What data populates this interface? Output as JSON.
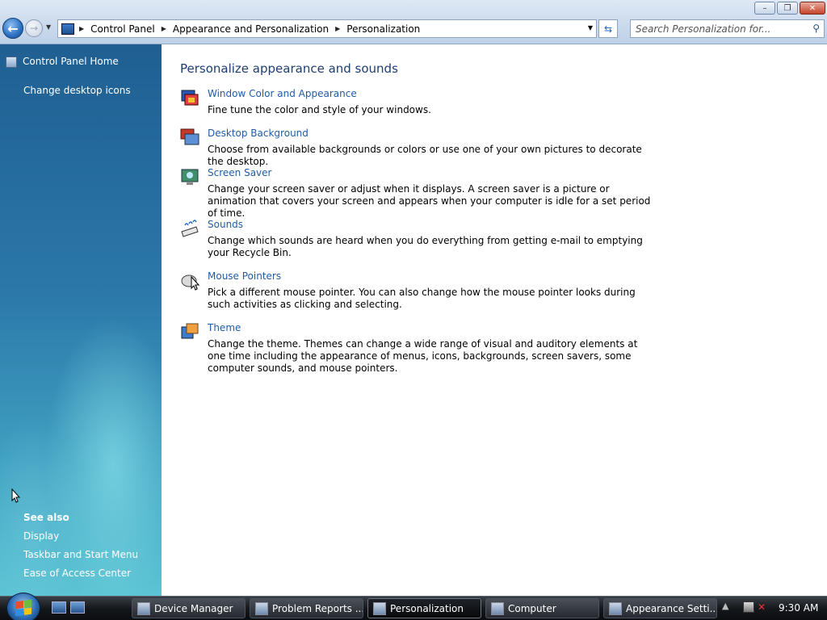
{
  "window": {
    "controls": {
      "minimize": "–",
      "maximize": "❐",
      "close": "✕"
    }
  },
  "address_bar": {
    "breadcrumbs": [
      "Control Panel",
      "Appearance and Personalization",
      "Personalization"
    ]
  },
  "search": {
    "placeholder": "Search Personalization for..."
  },
  "left_pane": {
    "home_link": "Control Panel Home",
    "tasks": [
      "Change desktop icons"
    ],
    "see_also_heading": "See also",
    "see_also": [
      "Display",
      "Taskbar and Start Menu",
      "Ease of Access Center"
    ]
  },
  "main": {
    "heading": "Personalize appearance and sounds",
    "tasks": [
      {
        "title": "Window Color and Appearance",
        "description": "Fine tune the color and style of your windows.",
        "icon": "window-color-icon"
      },
      {
        "title": "Desktop Background",
        "description": "Choose from available backgrounds or colors or use one of your own pictures to decorate the desktop.",
        "icon": "desktop-background-icon"
      },
      {
        "title": "Screen Saver",
        "description": "Change your screen saver or adjust when it displays. A screen saver is a picture or animation that covers your screen and appears when your computer is idle for a set period of time.",
        "icon": "screen-saver-icon"
      },
      {
        "title": "Sounds",
        "description": "Change which sounds are heard when you do everything from getting e-mail to emptying your Recycle Bin.",
        "icon": "sounds-icon"
      },
      {
        "title": "Mouse Pointers",
        "description": "Pick a different mouse pointer. You can also change how the mouse pointer looks during such activities as clicking and selecting.",
        "icon": "mouse-pointers-icon"
      },
      {
        "title": "Theme",
        "description": "Change the theme. Themes can change a wide range of visual and auditory elements at one time including the appearance of menus, icons, backgrounds, screen savers, some computer sounds, and mouse pointers.",
        "icon": "theme-icon"
      }
    ]
  },
  "taskbar": {
    "buttons": [
      {
        "label": "Device Manager",
        "active": false
      },
      {
        "label": "Problem Reports ...",
        "active": false
      },
      {
        "label": "Personalization",
        "active": true
      },
      {
        "label": "Computer",
        "active": false
      },
      {
        "label": "Appearance Setti...",
        "active": false
      }
    ],
    "clock": "9:30 AM"
  },
  "colors": {
    "link": "#1f5ca6",
    "heading": "#1e3f6e",
    "left_pane_top": "#1f5f92",
    "left_pane_bottom": "#5cc4d4"
  }
}
